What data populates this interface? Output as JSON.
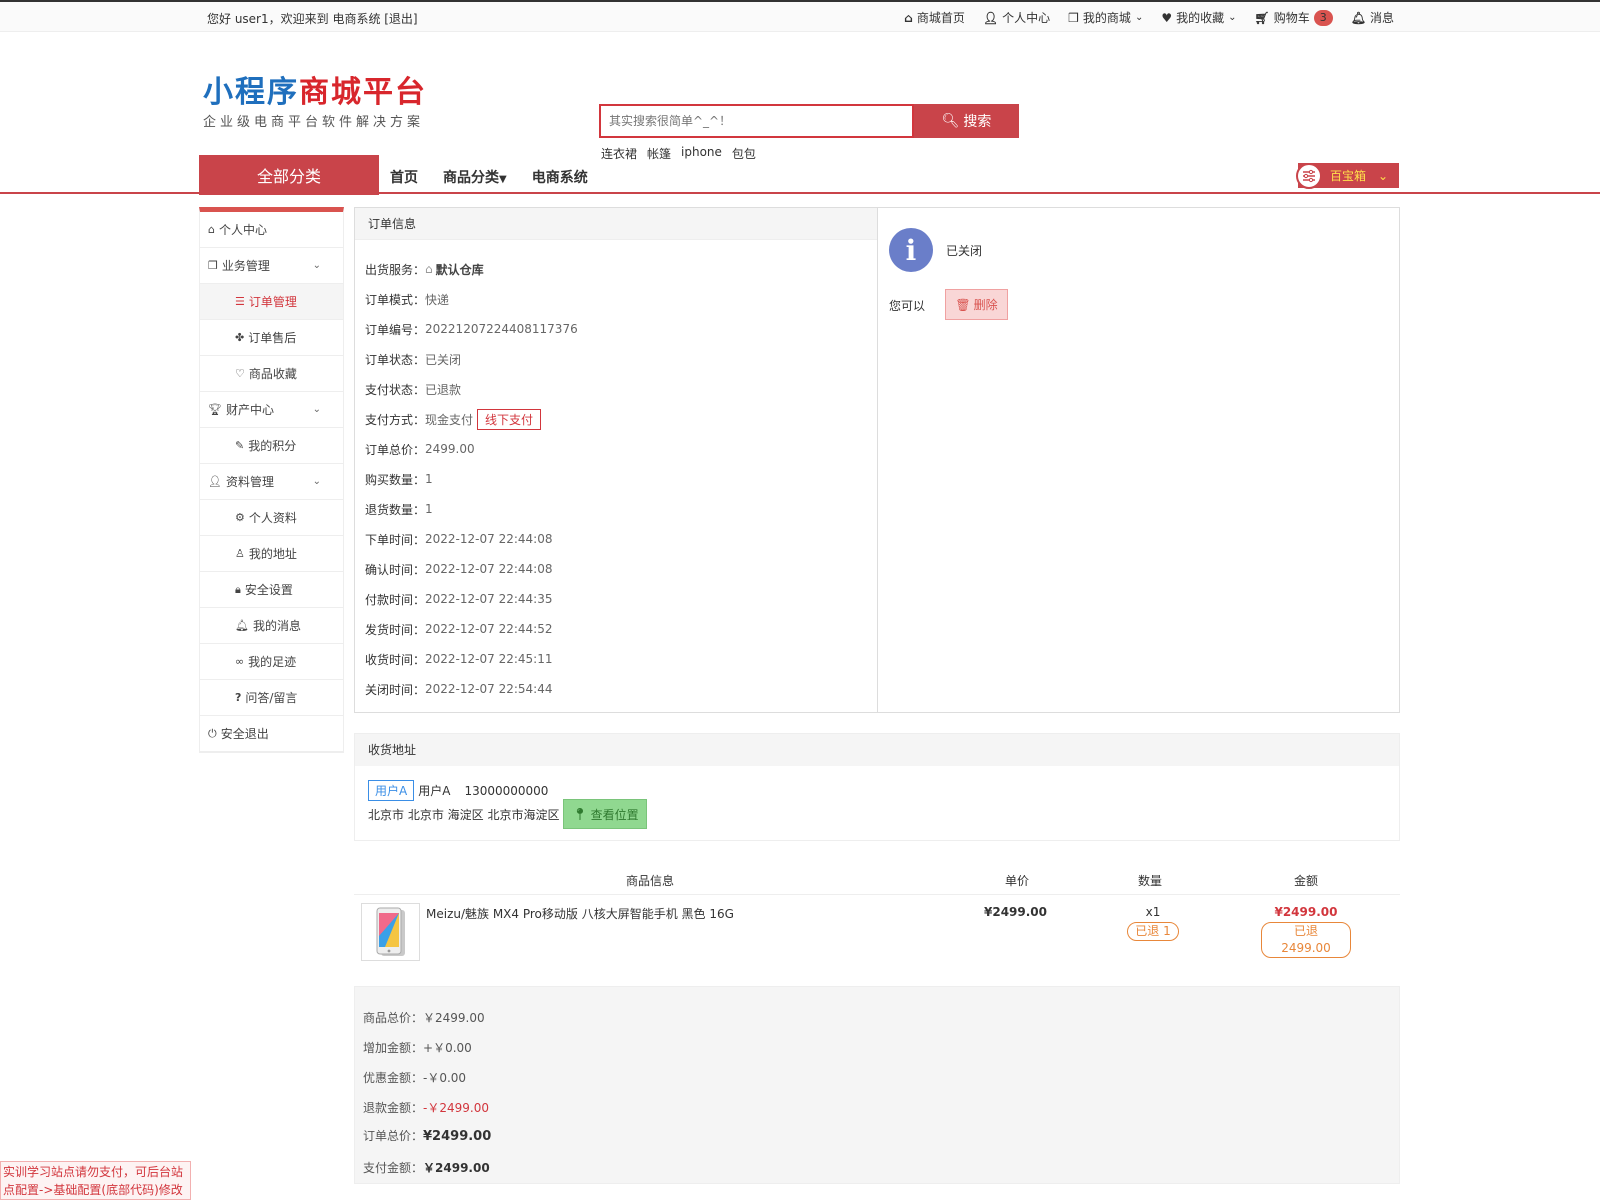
{
  "topbar": {
    "welcome": "您好 user1，欢迎来到 电商系统 [退出]",
    "nav": [
      "商城首页",
      "个人中心",
      "我的商城",
      "我的收藏",
      "购物车",
      "消息"
    ],
    "cart_count": "3"
  },
  "logo": {
    "part1": "小程序",
    "part2": "商城平台",
    "subtitle": "企业级电商平台软件解决方案"
  },
  "search": {
    "placeholder": "其实搜索很简单^_^！",
    "button": "搜索",
    "hotwords": [
      "连衣裙",
      "帐篷",
      "iphone",
      "包包"
    ]
  },
  "mainnav": {
    "all_categories": "全部分类",
    "links": [
      "首页",
      "商品分类",
      "电商系统"
    ],
    "treasure": "百宝箱"
  },
  "sidebar": {
    "items": [
      {
        "label": "个人中心"
      },
      {
        "label": "业务管理"
      },
      {
        "label": "订单管理"
      },
      {
        "label": "订单售后"
      },
      {
        "label": "商品收藏"
      },
      {
        "label": "财产中心"
      },
      {
        "label": "我的积分"
      },
      {
        "label": "资料管理"
      },
      {
        "label": "个人资料"
      },
      {
        "label": "我的地址"
      },
      {
        "label": "安全设置"
      },
      {
        "label": "我的消息"
      },
      {
        "label": "我的足迹"
      },
      {
        "label": "问答/留言"
      },
      {
        "label": "安全退出"
      }
    ]
  },
  "order": {
    "section_title": "订单信息",
    "rows": [
      {
        "k": "出货服务：",
        "v": "默认仓库"
      },
      {
        "k": "订单模式：",
        "v": "快递"
      },
      {
        "k": "订单编号：",
        "v": "20221207224408117376"
      },
      {
        "k": "订单状态：",
        "v": "已关闭"
      },
      {
        "k": "支付状态：",
        "v": "已退款"
      },
      {
        "k": "支付方式：",
        "v": "现金支付"
      },
      {
        "k": "订单总价：",
        "v": "2499.00"
      },
      {
        "k": "购买数量：",
        "v": "1"
      },
      {
        "k": "退货数量：",
        "v": "1"
      },
      {
        "k": "下单时间：",
        "v": "2022-12-07 22:44:08"
      },
      {
        "k": "确认时间：",
        "v": "2022-12-07 22:44:08"
      },
      {
        "k": "付款时间：",
        "v": "2022-12-07 22:44:35"
      },
      {
        "k": "发货时间：",
        "v": "2022-12-07 22:44:52"
      },
      {
        "k": "收货时间：",
        "v": "2022-12-07 22:45:11"
      },
      {
        "k": "关闭时间：",
        "v": "2022-12-07 22:54:44"
      }
    ],
    "pay_tag": "线下支付",
    "status": "已关闭",
    "can_do": "您可以",
    "delete_button": "删除"
  },
  "address": {
    "section_title": "收货地址",
    "tag": "用户A",
    "name": "用户A",
    "phone": "13000000000",
    "full": "北京市 北京市 海淀区 北京市海淀区",
    "view_button": "查看位置"
  },
  "goods": {
    "headers": [
      "商品信息",
      "单价",
      "数量",
      "金额"
    ],
    "items": [
      {
        "title": "Meizu/魅族 MX4 Pro移动版 八核大屏智能手机 黑色 16G",
        "price": "¥2499.00",
        "qty": "x1",
        "returned_qty": "已退 1",
        "amount": "¥2499.00",
        "returned_amount": "已退 2499.00"
      }
    ]
  },
  "summary": [
    {
      "k": "商品总价：",
      "v": "￥2499.00"
    },
    {
      "k": "增加金额：",
      "v": "+￥0.00"
    },
    {
      "k": "优惠金额：",
      "v": "-￥0.00"
    },
    {
      "k": "退款金额：",
      "v": "-￥2499.00"
    },
    {
      "k": "订单总价：",
      "v": "¥2499.00"
    },
    {
      "k": "支付金额：",
      "v": "￥2499.00"
    }
  ],
  "notice": "实训学习站点请勿支付，可后台站点配置->基础配置(底部代码)修改",
  "colors": {
    "accent": "#c9444a",
    "brand_blue": "#1f6fbd",
    "brand_red": "#d8262c"
  }
}
